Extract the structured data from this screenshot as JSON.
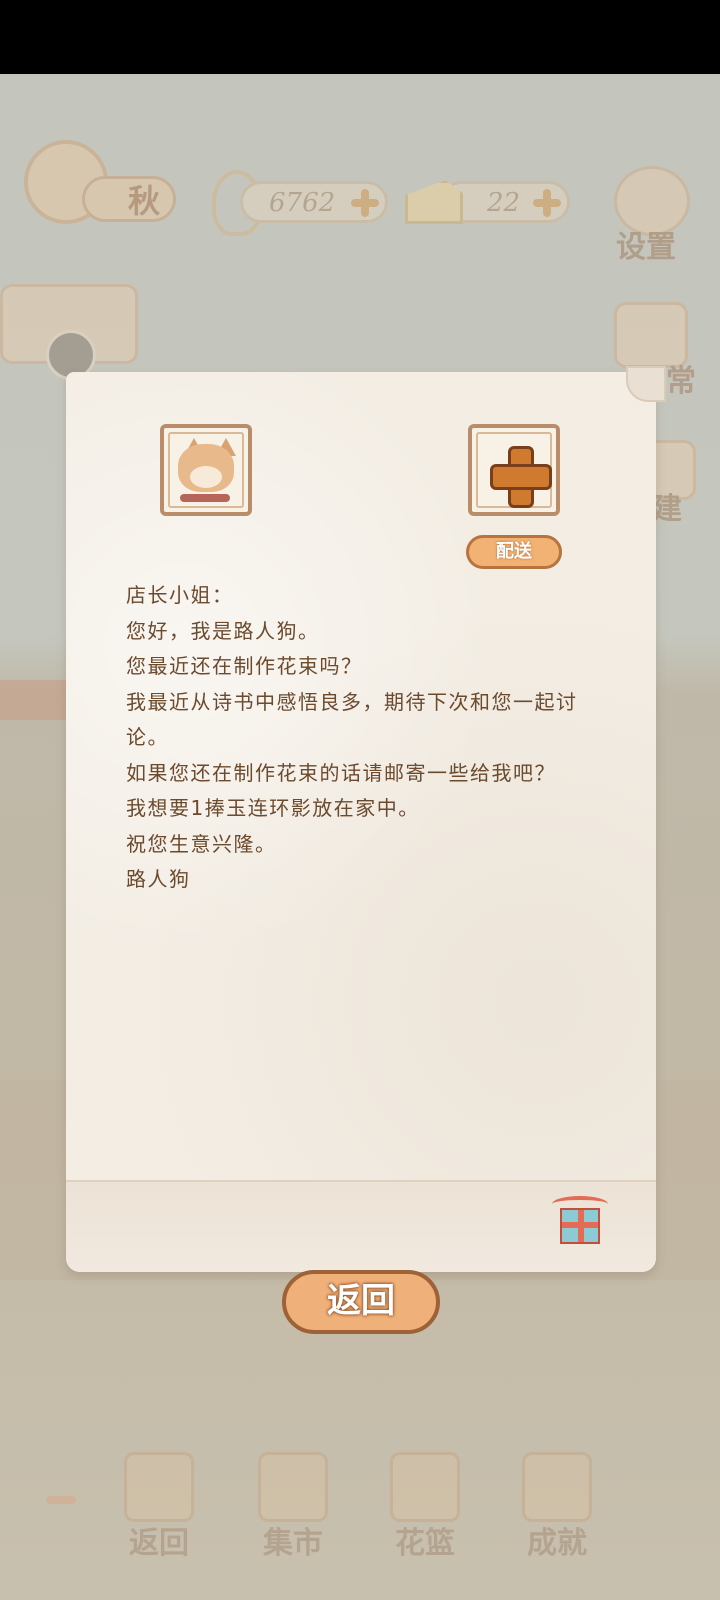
{
  "hud": {
    "season": "秋",
    "fish_count": "6762",
    "cheese_count": "22",
    "settings_label": "设置",
    "daily_label": "日常",
    "build_label": "建"
  },
  "letter_dialog": {
    "deliver_label": "配送",
    "lines": [
      "店长小姐：",
      "您好，我是路人狗。",
      "您最近还在制作花束吗？",
      "我最近从诗书中感悟良多，期待下次和您一起讨论。",
      "如果您还在制作花束的话请邮寄一些给我吧？",
      "我想要1捧玉连环影放在家中。",
      "祝您生意兴隆。",
      "路人狗"
    ],
    "return_label": "返回"
  },
  "bottom_nav": {
    "items": [
      {
        "label": "返回",
        "icon": "window-icon"
      },
      {
        "label": "集市",
        "icon": "market-stall-icon"
      },
      {
        "label": "花篮",
        "icon": "flower-basket-icon"
      },
      {
        "label": "成就",
        "icon": "trophy-icon"
      }
    ]
  },
  "colors": {
    "accent_orange": "#f0b07a",
    "button_border": "#9d6237",
    "letter_text": "#6b4a2e",
    "paper": "#f3ede4"
  }
}
